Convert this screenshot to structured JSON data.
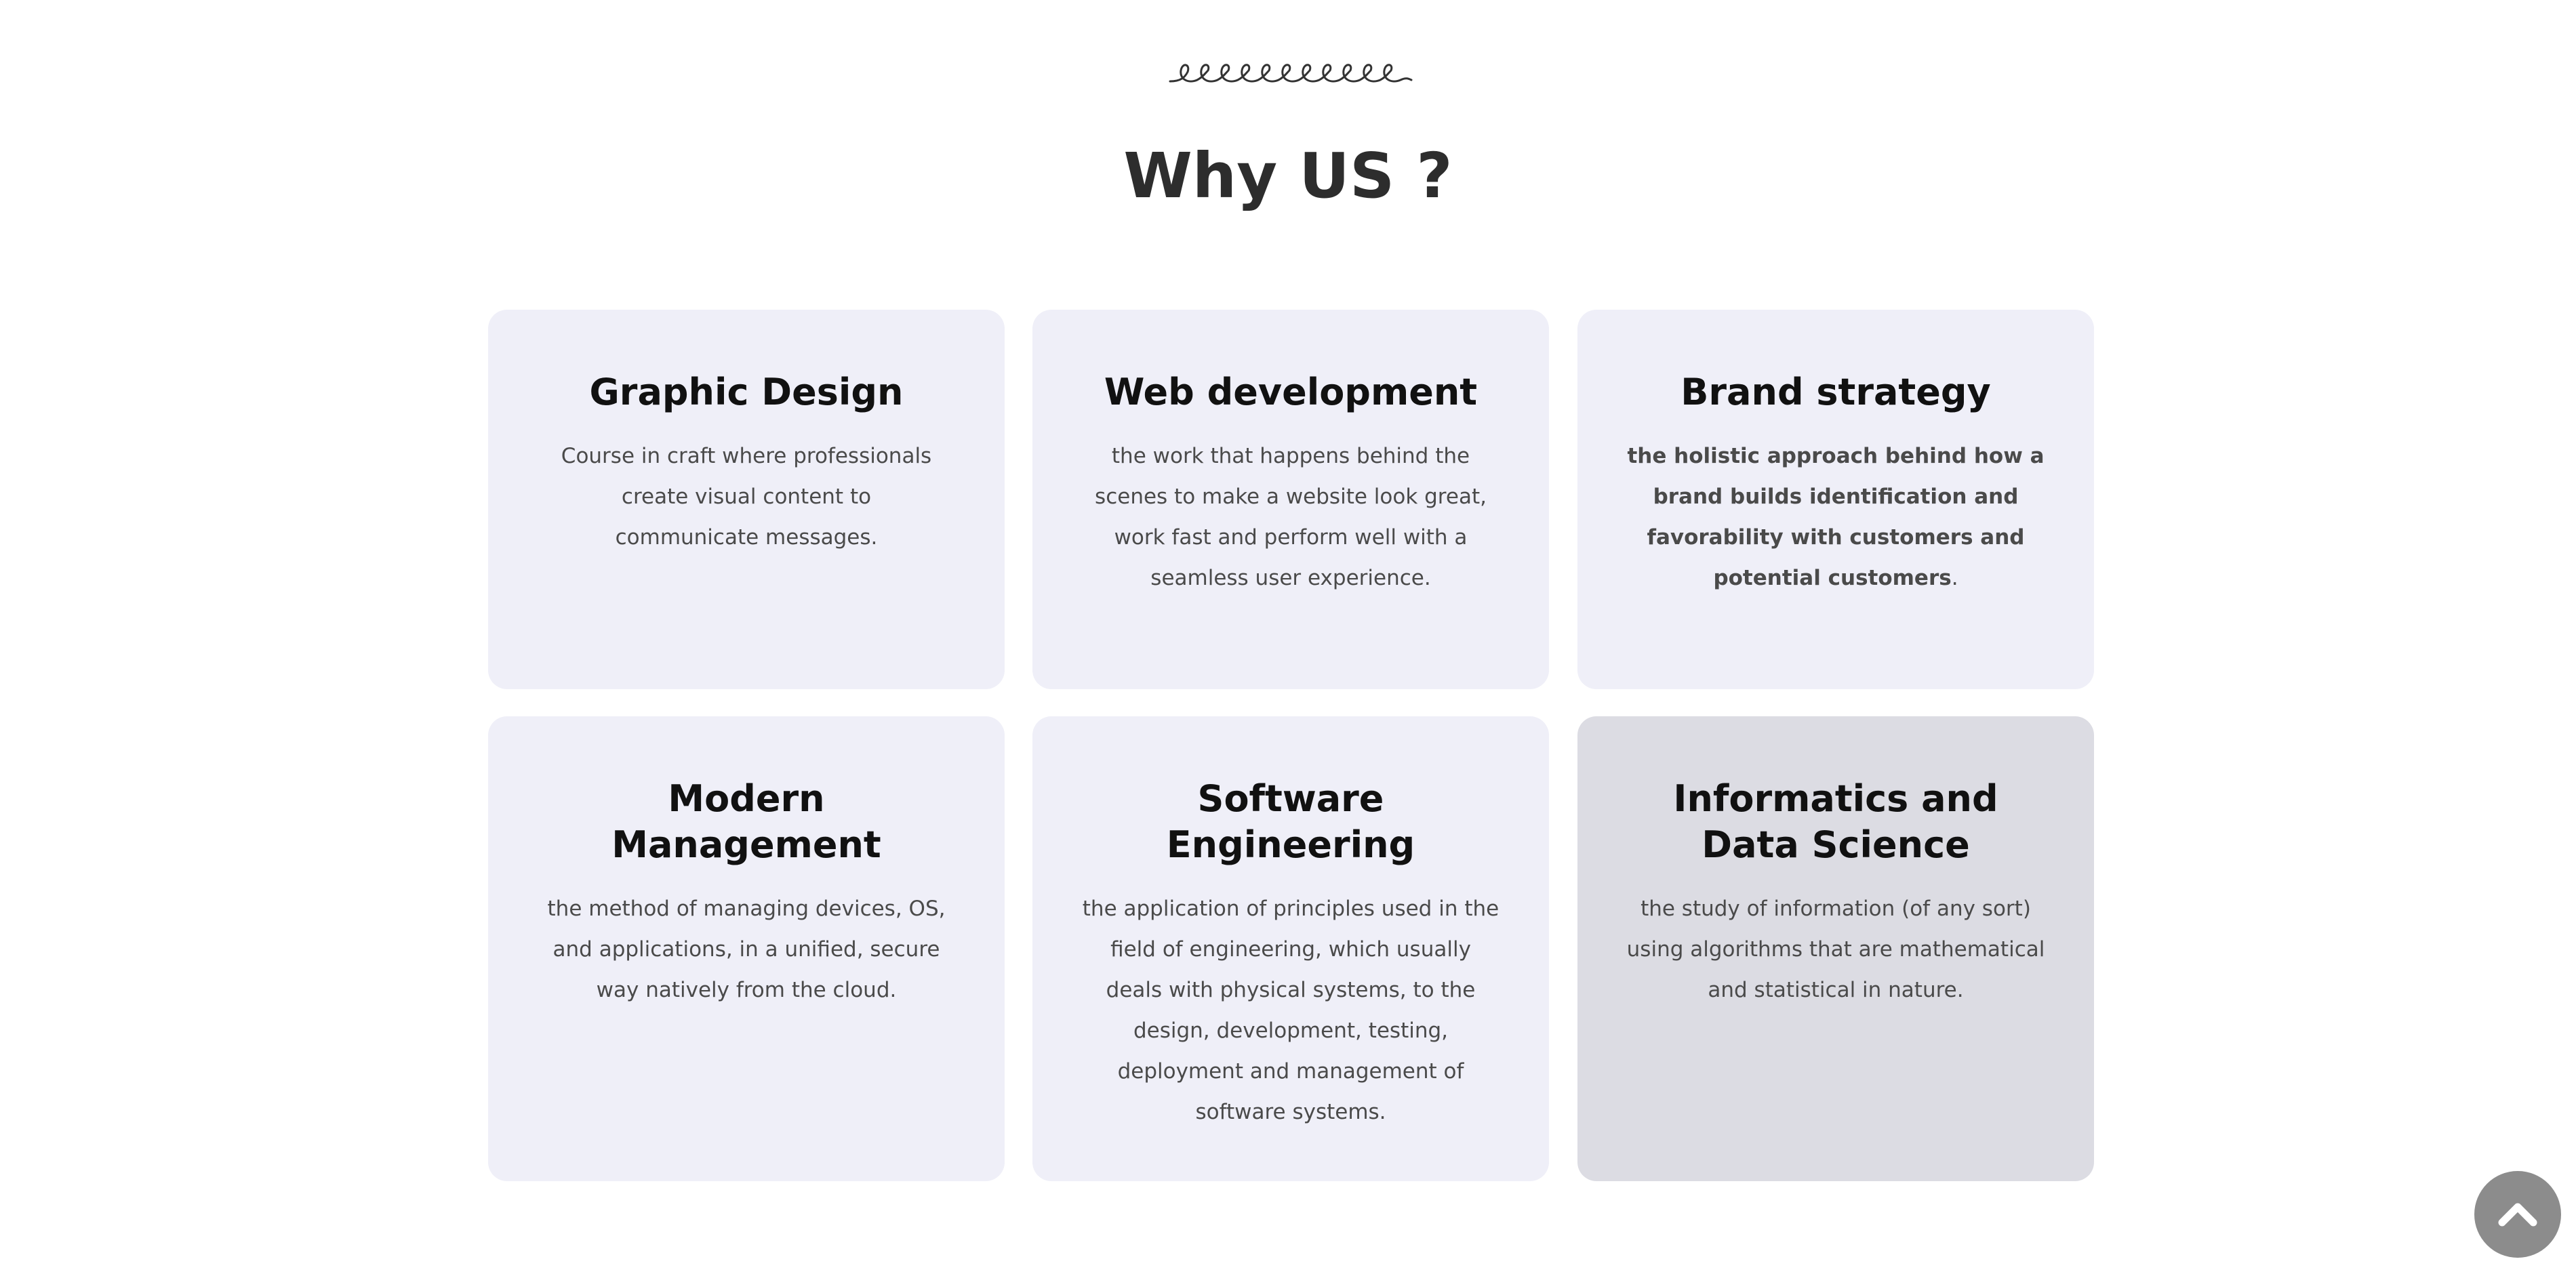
{
  "section": {
    "title": "Why US ?"
  },
  "cards": [
    {
      "title": "Graphic Design",
      "description": "Course in craft where professionals create visual content to communicate messages."
    },
    {
      "title": "Web development",
      "description": "the work that happens behind the scenes to make a website look great, work fast and perform well with a seamless user experience."
    },
    {
      "title": "Brand strategy",
      "description": "the holistic approach behind how a brand builds identification and favorability with customers and potential customers",
      "description_suffix": "."
    },
    {
      "title": "Modern Management",
      "description": "the method of managing devices, OS, and applications, in a unified, secure way natively from the cloud."
    },
    {
      "title": "Software Engineering",
      "description": "the application of principles used in the field of engineering, which usually deals with physical systems, to the design, development, testing, deployment and management of software systems."
    },
    {
      "title": "Informatics and Data Science",
      "description": "the study of information (of any sort) using algorithms that are mathematical and statistical in nature."
    }
  ],
  "icons": {
    "decoration": "squiggle-divider-icon",
    "scroll_top": "chevron-up-icon"
  },
  "colors": {
    "card_background": "#efeff8",
    "card_active_background": "#dcdce3",
    "heading": "#2d2d2d",
    "scroll_button": "#8c8c8c"
  }
}
